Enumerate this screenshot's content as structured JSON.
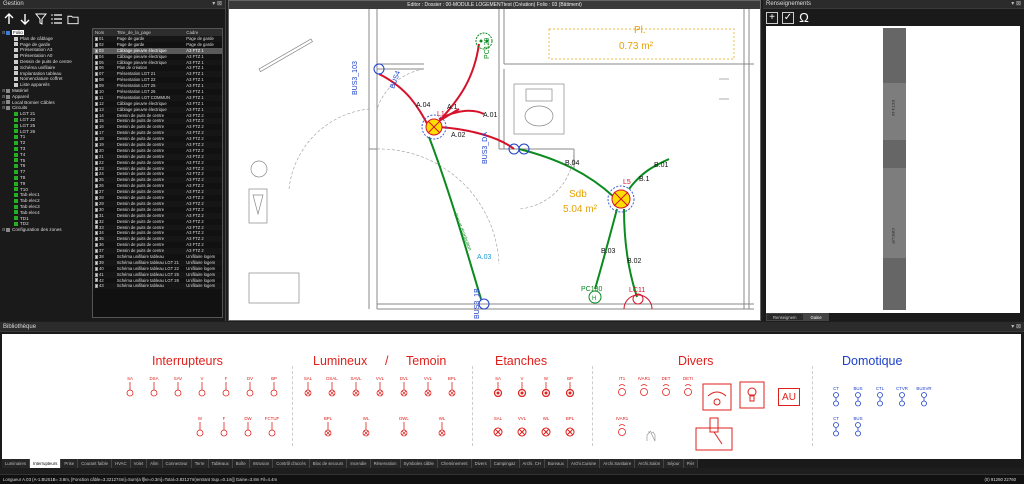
{
  "gestion": {
    "title": "Gestion",
    "tree": [
      {
        "label": "Folio",
        "level": 0,
        "color": "#3b7be0",
        "selected": true
      },
      {
        "label": "Plan de câblage",
        "level": 1,
        "color": "#cccccc"
      },
      {
        "label": "Page de garde",
        "level": 1,
        "color": "#cccccc"
      },
      {
        "label": "Présentation A3",
        "level": 1,
        "color": "#cccccc"
      },
      {
        "label": "Présentation A0",
        "level": 1,
        "color": "#cccccc"
      },
      {
        "label": "Dessin de puits de centre",
        "level": 1,
        "color": "#cccccc"
      },
      {
        "label": "Schéma unifilaire",
        "level": 1,
        "color": "#cccccc"
      },
      {
        "label": "Implantation tableau",
        "level": 1,
        "color": "#cccccc"
      },
      {
        "label": "Nomenclature coffret",
        "level": 1,
        "color": "#cccccc"
      },
      {
        "label": "Liste appareils",
        "level": 1,
        "color": "#cccccc"
      },
      {
        "label": "Matériel",
        "level": 0,
        "color": "#888888"
      },
      {
        "label": "Appareil",
        "level": 0,
        "color": "#888888"
      },
      {
        "label": "Local Bornier Câbles",
        "level": 0,
        "color": "#888888"
      },
      {
        "label": "Circuits",
        "level": 0,
        "color": "#888888"
      },
      {
        "label": "LGT 21",
        "level": 1,
        "color": "#22b022"
      },
      {
        "label": "LGT 22",
        "level": 1,
        "color": "#22b022"
      },
      {
        "label": "LGT 25",
        "level": 1,
        "color": "#22b022"
      },
      {
        "label": "LGT 26",
        "level": 1,
        "color": "#22b022"
      },
      {
        "label": "T1",
        "level": 1,
        "color": "#22b022"
      },
      {
        "label": "T2",
        "level": 1,
        "color": "#22b022"
      },
      {
        "label": "T3",
        "level": 1,
        "color": "#22b022"
      },
      {
        "label": "T4",
        "level": 1,
        "color": "#22b022"
      },
      {
        "label": "T5",
        "level": 1,
        "color": "#22b022"
      },
      {
        "label": "T6",
        "level": 1,
        "color": "#22b022"
      },
      {
        "label": "T7",
        "level": 1,
        "color": "#22b022"
      },
      {
        "label": "T8",
        "level": 1,
        "color": "#22b022"
      },
      {
        "label": "T9",
        "level": 1,
        "color": "#22b022"
      },
      {
        "label": "T10",
        "level": 1,
        "color": "#22b022"
      },
      {
        "label": "Tab elec1",
        "level": 1,
        "color": "#22b022"
      },
      {
        "label": "Tab elec2",
        "level": 1,
        "color": "#22b022"
      },
      {
        "label": "Tab elec3",
        "level": 1,
        "color": "#22b022"
      },
      {
        "label": "Tab elec4",
        "level": 1,
        "color": "#22b022"
      },
      {
        "label": "TD1",
        "level": 1,
        "color": "#22b022"
      },
      {
        "label": "TD2",
        "level": 1,
        "color": "#22b022"
      },
      {
        "label": "Configuration des zones",
        "level": 0,
        "color": "#888888"
      }
    ],
    "pages_header": [
      "Nom",
      "Titre_de_la_page",
      "Cadre"
    ],
    "pages": [
      [
        "01",
        "Page de garde",
        "Page de garde"
      ],
      [
        "02",
        "Page de garde",
        "Page de garde"
      ],
      [
        "03",
        "Câblage pieuvre électrique",
        "A3 FTZ 1"
      ],
      [
        "04",
        "Câblage pieuvre électrique",
        "A3 FTZ 1"
      ],
      [
        "05",
        "Câblage pieuvre électrique",
        "A3 FTZ 1"
      ],
      [
        "06",
        "Plan de création",
        "A3 FTZ 1"
      ],
      [
        "07",
        "Présentation LGT 21",
        "A3 FTZ 1"
      ],
      [
        "08",
        "Présentation LGT 22",
        "A3 FTZ 1"
      ],
      [
        "09",
        "Présentation LGT 25",
        "A3 FTZ 1"
      ],
      [
        "10",
        "Présentation LGT 26",
        "A3 FTZ 1"
      ],
      [
        "11",
        "Présentation LGT COMMUN",
        "A3 FTZ 1"
      ],
      [
        "12",
        "Câblage pieuvre électrique",
        "A3 FTZ 1"
      ],
      [
        "13",
        "Câblage pieuvre électrique",
        "A3 FTZ 1"
      ],
      [
        "14",
        "Dessin de puits de centre",
        "A3 FTZ 2"
      ],
      [
        "15",
        "Dessin de puits de centre",
        "A3 FTZ 2"
      ],
      [
        "16",
        "Dessin de puits de centre",
        "A3 FTZ 2"
      ],
      [
        "17",
        "Dessin de puits de centre",
        "A3 FTZ 2"
      ],
      [
        "18",
        "Dessin de puits de centre",
        "A3 FTZ 2"
      ],
      [
        "19",
        "Dessin de puits de centre",
        "A3 FTZ 2"
      ],
      [
        "20",
        "Dessin de puits de centre",
        "A3 FTZ 2"
      ],
      [
        "21",
        "Dessin de puits de centre",
        "A3 FTZ 2"
      ],
      [
        "22",
        "Dessin de puits de centre",
        "A3 FTZ 2"
      ],
      [
        "23",
        "Dessin de puits de centre",
        "A3 FTZ 2"
      ],
      [
        "24",
        "Dessin de puits de centre",
        "A3 FTZ 2"
      ],
      [
        "25",
        "Dessin de puits de centre",
        "A3 FTZ 2"
      ],
      [
        "26",
        "Dessin de puits de centre",
        "A3 FTZ 2"
      ],
      [
        "27",
        "Dessin de puits de centre",
        "A3 FTZ 2"
      ],
      [
        "28",
        "Dessin de puits de centre",
        "A3 FTZ 2"
      ],
      [
        "29",
        "Dessin de puits de centre",
        "A3 FTZ 2"
      ],
      [
        "30",
        "Dessin de puits de centre",
        "A3 FTZ 2"
      ],
      [
        "31",
        "Dessin de puits de centre",
        "A3 FTZ 2"
      ],
      [
        "32",
        "Dessin de puits de centre",
        "A3 FTZ 2"
      ],
      [
        "33",
        "Dessin de puits de centre",
        "A3 FTZ 2"
      ],
      [
        "34",
        "Dessin de puits de centre",
        "A3 FTZ 2"
      ],
      [
        "35",
        "Dessin de puits de centre",
        "A3 FTZ 2"
      ],
      [
        "36",
        "Dessin de puits de centre",
        "A3 FTZ 2"
      ],
      [
        "37",
        "Dessin de puits de centre",
        "A3 FTZ 2"
      ],
      [
        "38",
        "Schéma unifilaire tableau",
        "Unifilaire logem"
      ],
      [
        "39",
        "Schéma unifilaire tableau LGT 21",
        "Unifilaire logem"
      ],
      [
        "40",
        "Schéma unifilaire tableau LGT 22",
        "Unifilaire logem"
      ],
      [
        "41",
        "Schéma unifilaire tableau LGT 25",
        "Unifilaire logem"
      ],
      [
        "42",
        "Schéma unifilaire tableau LGT 26",
        "Unifilaire logem"
      ],
      [
        "43",
        "Schéma unifilaire tableau",
        "Unifilaire logem"
      ]
    ]
  },
  "editor": {
    "title": "Editor : Dossier : 00-MODULE LOGEMENTtest  (Création)  Folio : 03  (Bâtiment)",
    "room_pl": "Pl.",
    "room_pl_area": "0.73 m²",
    "room_sdb": "Sdb",
    "room_sdb_area": "5.04 m²",
    "labels": [
      "A.04",
      "A.1",
      "A.01",
      "A.02",
      "B.04",
      "B.01",
      "B.1",
      "L1",
      "L5",
      "A.03",
      "B.03",
      "B.02",
      "PC129",
      "PC130",
      "LC11",
      "BUS3_103",
      "BUS4",
      "BUS3_DA",
      "BUS3_1B",
      "Circuit distribution"
    ]
  },
  "rens": {
    "title": "Renseignements",
    "tools": [
      "+",
      "✓",
      "Ω"
    ],
    "bar_label_top": "ECT4:16",
    "bar_label_bot": "CIRCUIT",
    "tabs": [
      "Renseignem",
      "Gaine"
    ],
    "active_tab": 1
  },
  "biblio": {
    "title": "Bibliothèque",
    "categories": [
      "Interrupteurs",
      "Lumineux",
      "/",
      "Temoin",
      "Etanches",
      "Divers",
      "Domotique"
    ],
    "interrupteurs_row1": [
      "SA",
      "DSA",
      "SAV",
      "V",
      "F",
      "DV",
      "BP"
    ],
    "interrupteurs_row2": [
      "W",
      "F",
      "DW",
      "FCTUF"
    ],
    "lumineux_row1": [
      "SAL",
      "DSAL",
      "SAVL",
      "VVL",
      "DVL",
      "VVL",
      "BPL"
    ],
    "lumineux_row2": [
      "BPL",
      "WL",
      "DWL",
      "WL"
    ],
    "etanches_row1": [
      "SA",
      "V",
      "W",
      "BP"
    ],
    "etanches_row2": [
      "SAL",
      "VVL",
      "WL",
      "BPL"
    ],
    "divers_row1": [
      "IT1",
      "IVAR1",
      "DET",
      "DETI",
      "TC",
      "IC",
      "AU"
    ],
    "divers_row2": [
      "IVAR1",
      "CD"
    ],
    "domotique_row1": [
      "CT",
      "BUS",
      "CTL",
      "CTVR",
      "BUSVR"
    ],
    "domotique_row2": [
      "CT",
      "BUS"
    ],
    "au_text": "AU",
    "tabs": [
      "Luminaires",
      "Interrupteurs",
      "Prise",
      "Courant faible",
      "HVAC",
      "Volet",
      "Alim",
      "Connecteur",
      "Terre",
      "Tableaux",
      "Boîte",
      "Intrusion",
      "Contrôl d'accès",
      "Bloc de secours",
      "Incendie",
      "Réservation",
      "Symboles câble",
      "Cheminement",
      "Divers",
      "Campingaz",
      "Archi. CH",
      "Bureaux",
      "Archi.Cuisine",
      "Archi.Sanitaire",
      "Archi.Salon",
      "Séjour",
      "Pièr"
    ],
    "active_tab": 1
  },
  "status": {
    "text": "Longueur A.03 (A-1.BUS1B= 3.8m, [Fonction câble=3.321274m]=Sum(a f[ke=0.3m]=Total=3.82127m)entrant Sup.=0.1m]] Gaine=3.8m Fil=4.4m",
    "right": "(0)  91260  22760"
  },
  "colors": {
    "accent_red": "#e0201c",
    "accent_blue": "#1b3fc8",
    "wire_red": "#d6122a",
    "wire_green": "#0b8a1f",
    "room_label": "#e6a100"
  }
}
